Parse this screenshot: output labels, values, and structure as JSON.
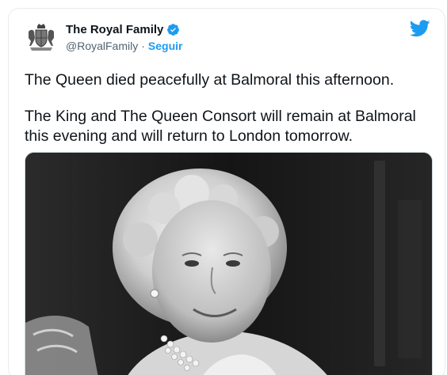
{
  "tweet": {
    "display_name": "The Royal Family",
    "handle": "@RoyalFamily",
    "separator": "·",
    "follow_label": "Seguir",
    "paragraph_1": "The Queen died peacefully at Balmoral this afternoon.",
    "paragraph_2_line_1": "The King and The Queen Consort will remain at Balmoral",
    "paragraph_2_line_2": "this evening and will return to London tomorrow."
  },
  "icons": {
    "avatar": "royal-crest-icon",
    "verified": "verified-badge-icon",
    "brand": "twitter-bird-icon"
  },
  "colors": {
    "accent": "#1d9bf0",
    "text": "#0f1419",
    "secondary_text": "#536471",
    "border": "#e6ecf0"
  },
  "media": {
    "type": "photo",
    "tone": "black-and-white"
  }
}
